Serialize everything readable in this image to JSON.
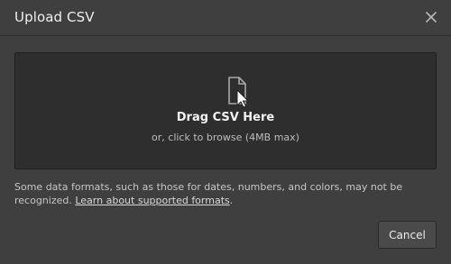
{
  "dialog": {
    "title": "Upload CSV",
    "close_icon": "close-icon"
  },
  "dropzone": {
    "icon": "file-cursor-icon",
    "title": "Drag CSV Here",
    "subtitle": "or, click to browse (4MB max)"
  },
  "note": {
    "text": "Some data formats, such as those for dates, numbers, and colors, may not be recognized. ",
    "link_label": "Learn about supported formats",
    "suffix": "."
  },
  "footer": {
    "cancel_label": "Cancel"
  },
  "colors": {
    "background": "#3f3f3f",
    "dropzone": "#2e2e2e",
    "text": "#e6e6e6"
  }
}
